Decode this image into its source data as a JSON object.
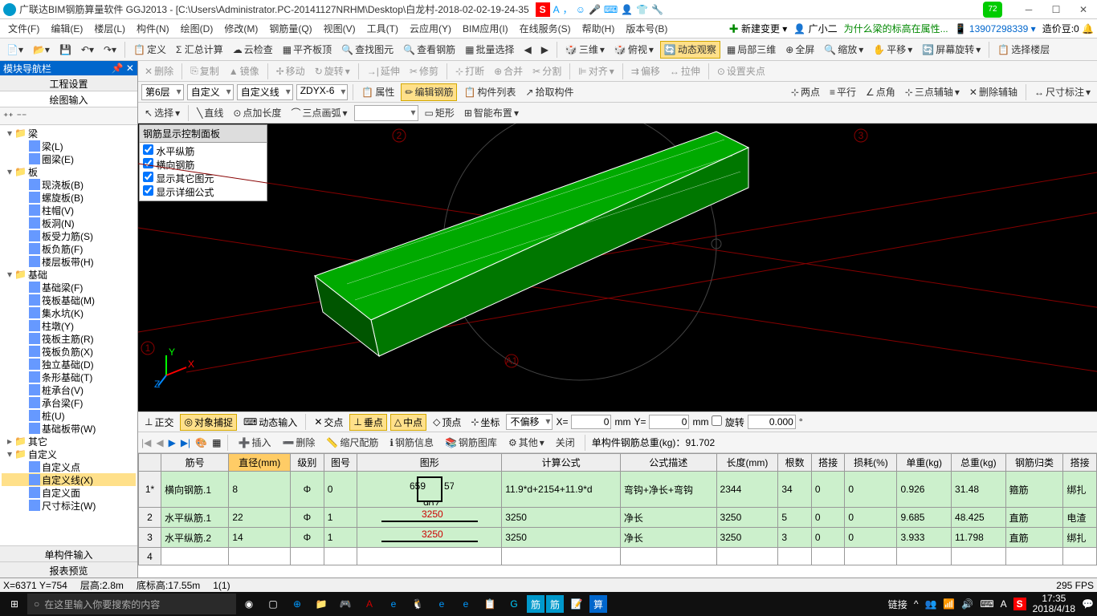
{
  "title": "广联达BIM钢筋算量软件 GGJ2013 - [C:\\Users\\Administrator.PC-20141127NRHM\\Desktop\\白龙村-2018-02-02-19-24-35",
  "ime_badge": "S",
  "badge72": "72",
  "menubar": [
    "文件(F)",
    "编辑(E)",
    "楼层(L)",
    "构件(N)",
    "绘图(D)",
    "修改(M)",
    "钢筋量(Q)",
    "视图(V)",
    "工具(T)",
    "云应用(Y)",
    "BIM应用(I)",
    "在线服务(S)",
    "帮助(H)",
    "版本号(B)"
  ],
  "menubar_right": {
    "new": "新建变更",
    "user": "广小二",
    "tip": "为什么梁的标高在属性...",
    "phone": "13907298339",
    "cost_label": "造价豆:0"
  },
  "toolbar1": {
    "define": "定义",
    "sum": "Σ 汇总计算",
    "cloud": "云检查",
    "flat": "平齐板顶",
    "find": "查找图元",
    "rebar": "查看钢筋",
    "batch": "批量选择",
    "d3": "三维",
    "side": "俯视",
    "dyn": "动态观察",
    "local": "局部三维",
    "full": "全屏",
    "zoom": "缩放",
    "pan": "平移",
    "rot": "屏幕旋转",
    "selfloor": "选择楼层"
  },
  "toolbar_edit": {
    "delete": "删除",
    "copy": "复制",
    "mirror": "镜像",
    "move": "移动",
    "rotate": "旋转",
    "extend": "延伸",
    "trim": "修剪",
    "break": "打断",
    "merge": "合并",
    "split": "分割",
    "align": "对齐",
    "offset": "偏移",
    "stretch": "拉伸",
    "setpt": "设置夹点"
  },
  "toolbar3": {
    "floor": "第6层",
    "custom": "自定义",
    "customline": "自定义线",
    "zdyx": "ZDYX-6",
    "attr": "属性",
    "editrebar": "编辑钢筋",
    "list": "构件列表",
    "pick": "拾取构件",
    "twopt": "两点",
    "parallel": "平行",
    "angle": "点角",
    "threept": "三点辅轴",
    "delaux": "删除辅轴",
    "dim": "尺寸标注"
  },
  "toolbar4": {
    "select": "选择",
    "line": "直线",
    "ptlen": "点加长度",
    "arc": "三点画弧",
    "rect": "矩形",
    "smart": "智能布置"
  },
  "left_panel": {
    "title": "模块导航栏",
    "tab1": "工程设置",
    "tab2": "绘图输入"
  },
  "tree": {
    "beam": "梁",
    "beam_l": "梁(L)",
    "ring": "圈梁(E)",
    "board": "板",
    "cast": "现浇板(B)",
    "spiral": "螺旋板(B)",
    "column_cap": "柱帽(V)",
    "hole": "板洞(N)",
    "force": "板受力筋(S)",
    "neg": "板负筋(F)",
    "strip": "楼层板带(H)",
    "base": "基础",
    "base_beam": "基础梁(F)",
    "raft": "筏板基础(M)",
    "sump": "集水坑(K)",
    "pier": "柱墩(Y)",
    "raft_main": "筏板主筋(R)",
    "raft_neg": "筏板负筋(X)",
    "indep": "独立基础(D)",
    "strip_base": "条形基础(T)",
    "pile_cap": "桩承台(V)",
    "bearing": "承台梁(F)",
    "pile": "桩(U)",
    "base_strip": "基础板带(W)",
    "other": "其它",
    "custom": "自定义",
    "custom_pt": "自定义点",
    "custom_line": "自定义线(X)",
    "custom_face": "自定义面",
    "dim": "尺寸标注(W)"
  },
  "bottom_tabs": {
    "single": "单构件输入",
    "preview": "报表预览"
  },
  "rebar_panel": {
    "title": "钢筋显示控制面板",
    "items": [
      "水平纵筋",
      "横向钢筋",
      "显示其它图元",
      "显示详细公式"
    ]
  },
  "snapbar": {
    "ortho": "正交",
    "objsnap": "对象捕捉",
    "dyninput": "动态输入",
    "cross": "交点",
    "perp": "垂点",
    "mid": "中点",
    "vertex": "顶点",
    "coord": "坐标",
    "nooffset": "不偏移",
    "x": "0",
    "y": "0",
    "rotate": "旋转",
    "angle": "0.000"
  },
  "rebar_tb": {
    "insert": "插入",
    "delete": "删除",
    "scale": "缩尺配筋",
    "info": "钢筋信息",
    "lib": "钢筋图库",
    "other": "其他",
    "close": "关闭",
    "total_label": "单构件钢筋总重(kg)：",
    "total": "91.702"
  },
  "grid": {
    "headers": [
      "",
      "筋号",
      "直径(mm)",
      "级别",
      "图号",
      "图形",
      "计算公式",
      "公式描述",
      "长度(mm)",
      "根数",
      "搭接",
      "损耗(%)",
      "单重(kg)",
      "总重(kg)",
      "钢筋归类",
      "搭接"
    ],
    "rows": [
      {
        "n": "1*",
        "name": "横向钢筋.1",
        "dia": "8",
        "grade": "Φ",
        "code": "0",
        "shape": "rect",
        "formula": "11.9*d+2154+11.9*d",
        "desc": "弯钩+净长+弯钩",
        "len": "2344",
        "count": "34",
        "lap": "0",
        "loss": "0",
        "unit": "0.926",
        "total": "31.48",
        "cat": "箍筋",
        "lap2": "绑扎"
      },
      {
        "n": "2",
        "name": "水平纵筋.1",
        "dia": "22",
        "grade": "Φ",
        "code": "1",
        "shape": "line",
        "shape_val": "3250",
        "formula": "3250",
        "desc": "净长",
        "len": "3250",
        "count": "5",
        "lap": "0",
        "loss": "0",
        "unit": "9.685",
        "total": "48.425",
        "cat": "直筋",
        "lap2": "电渣"
      },
      {
        "n": "3",
        "name": "水平纵筋.2",
        "dia": "14",
        "grade": "Φ",
        "code": "1",
        "shape": "line",
        "shape_val": "3250",
        "formula": "3250",
        "desc": "净长",
        "len": "3250",
        "count": "3",
        "lap": "0",
        "loss": "0",
        "unit": "3.933",
        "total": "11.798",
        "cat": "直筋",
        "lap2": "绑扎"
      },
      {
        "n": "4",
        "name": "",
        "dia": "",
        "grade": "",
        "code": "",
        "shape": "",
        "formula": "",
        "desc": "",
        "len": "",
        "count": "",
        "lap": "",
        "loss": "",
        "unit": "",
        "total": "",
        "cat": "",
        "lap2": ""
      }
    ]
  },
  "status": {
    "xy": "X=6371 Y=754",
    "floor": "层高:2.8m",
    "bottom": "底标高:17.55m",
    "sel": "1(1)",
    "fps": "295 FPS"
  },
  "taskbar": {
    "search": "在这里输入你要搜索的内容",
    "link": "链接",
    "time": "17:35",
    "date": "2018/4/18"
  }
}
